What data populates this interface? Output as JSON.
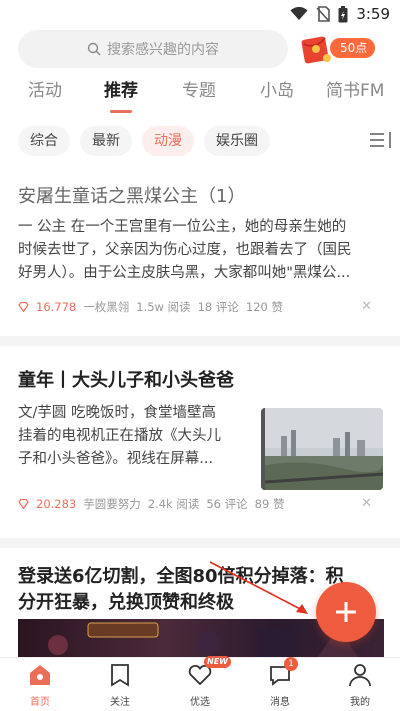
{
  "status_bar": {
    "time": "3:59"
  },
  "search": {
    "placeholder": "搜索感兴趣的内容"
  },
  "reward": {
    "points_label": "50点"
  },
  "top_tabs": [
    "活动",
    "推荐",
    "专题",
    "小岛",
    "简书FM"
  ],
  "sub_tabs": [
    "综合",
    "最新",
    "动漫",
    "娱乐圈"
  ],
  "articles": [
    {
      "title": "安屠生童话之黑煤公主（1）",
      "body_lines": [
        "一 公主 在一个王宫里有一位公主，她的母亲生她的",
        "时候去世了，父亲因为伤心过度，也跟着去了（国民",
        "好男人）。由于公主皮肤乌黑，大家都叫她\"黑煤公..."
      ],
      "diamonds": "16.778",
      "author": "一枚黑翎",
      "reads": "1.5w 阅读",
      "comments": "18 评论",
      "likes": "120 赞"
    },
    {
      "title": "童年丨大头儿子和小头爸爸",
      "body_lines": [
        "文/芋圆 吃晚饭时，食堂墙壁高",
        "挂着的电视机正在播放《大头儿",
        "子和小头爸爸》。视线在屏幕..."
      ],
      "diamonds": "20.283",
      "author": "芋圆要努力",
      "reads": "2.4k 阅读",
      "comments": "56 评论",
      "likes": "89 赞"
    },
    {
      "title_lines": [
        "登录送6亿切割，全图80倍积分掉落：积",
        "分开狂暴，兑换顶赞和终极"
      ]
    }
  ],
  "bottom_nav": [
    {
      "label": "首页",
      "icon": "home-icon"
    },
    {
      "label": "关注",
      "icon": "bookmark-icon"
    },
    {
      "label": "优选",
      "icon": "heart-icon",
      "badge": "NEW"
    },
    {
      "label": "消息",
      "icon": "message-icon",
      "badge": "1"
    },
    {
      "label": "我的",
      "icon": "profile-icon"
    }
  ],
  "colors": {
    "accent": "#ea6f5a",
    "fab": "#ef5b3e"
  }
}
